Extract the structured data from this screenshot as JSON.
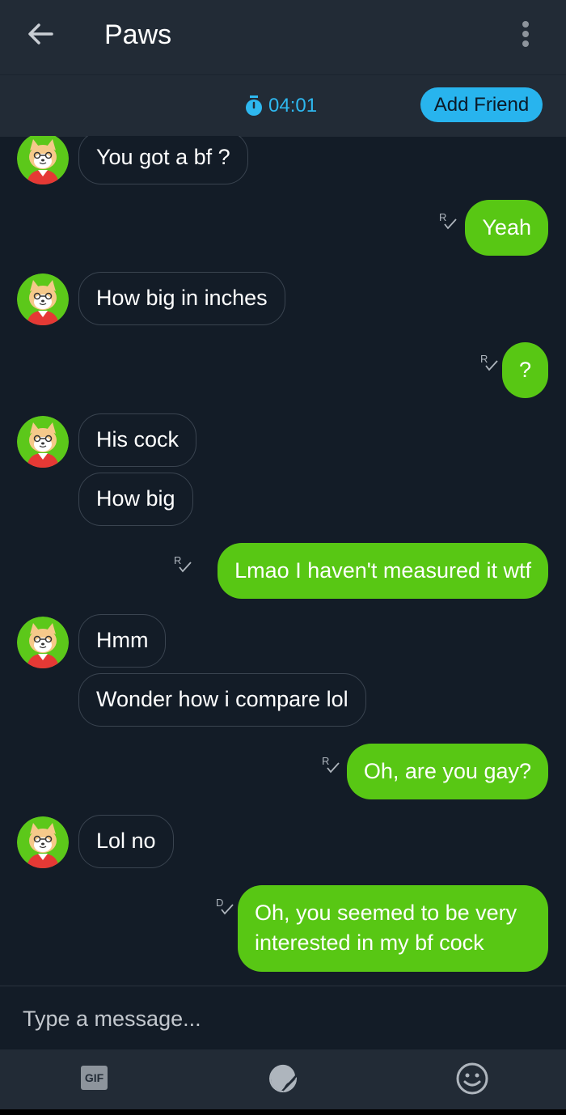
{
  "header": {
    "title": "Paws",
    "back_icon": "arrow-left-icon",
    "menu_icon": "more-vertical-icon"
  },
  "subheader": {
    "timer": "04:01",
    "timer_icon": "stopwatch-icon",
    "add_friend_label": "Add Friend"
  },
  "messages": [
    {
      "from": "them",
      "text": "You got a bf ?"
    },
    {
      "from": "me",
      "text": "Yeah",
      "receipt": "R"
    },
    {
      "from": "them",
      "text": "How big in inches"
    },
    {
      "from": "me",
      "text": "?",
      "receipt": "R"
    },
    {
      "from": "them",
      "text": "His cock"
    },
    {
      "from": "them",
      "text": "How big"
    },
    {
      "from": "me",
      "text": "Lmao I haven't measured it wtf",
      "receipt": "R"
    },
    {
      "from": "them",
      "text": "Hmm"
    },
    {
      "from": "them",
      "text": "Wonder how i compare lol"
    },
    {
      "from": "me",
      "text": "Oh, are you gay?",
      "receipt": "R"
    },
    {
      "from": "them",
      "text": "Lol no"
    },
    {
      "from": "me",
      "text": "Oh, you seemed to be very interested in my bf cock",
      "receipt": "D"
    }
  ],
  "composer": {
    "placeholder": "Type a message..."
  },
  "toolbar": {
    "gif_label": "GIF",
    "sticker_icon": "sticker-icon",
    "emoji_icon": "smiley-icon"
  },
  "colors": {
    "background": "#131c27",
    "bar": "#222b36",
    "outgoing_bubble": "#58c714",
    "accent": "#28b4ee"
  }
}
